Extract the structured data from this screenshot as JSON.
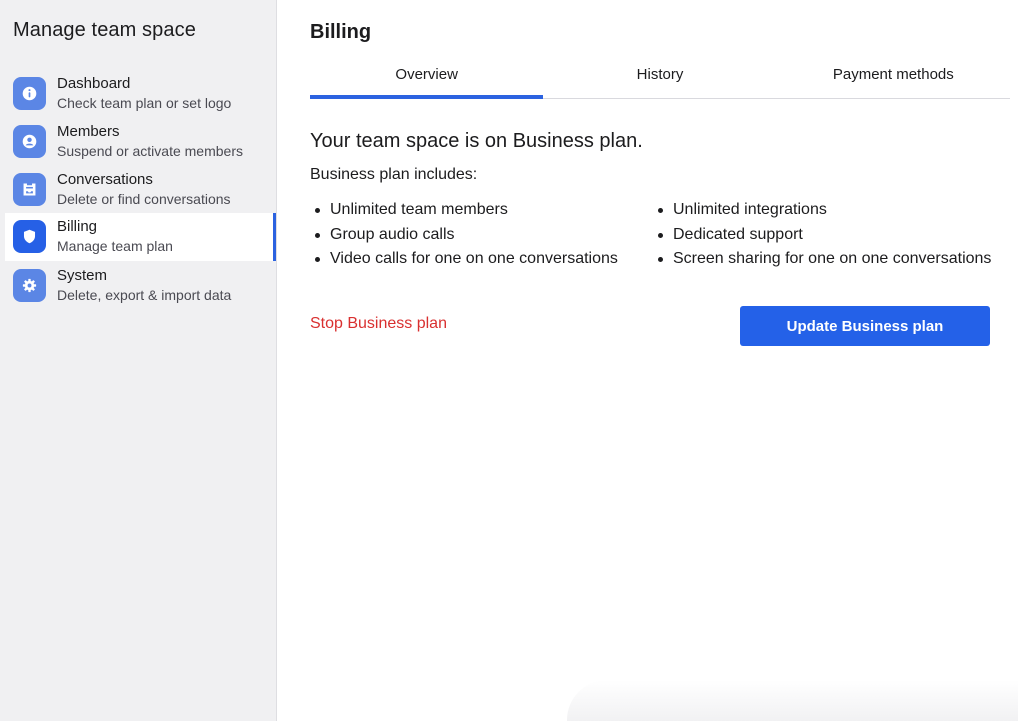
{
  "sidebar": {
    "title": "Manage team space",
    "items": [
      {
        "label": "Dashboard",
        "sub": "Check team plan or set logo",
        "icon": "info-icon",
        "active": false
      },
      {
        "label": "Members",
        "sub": "Suspend or activate members",
        "icon": "user-icon",
        "active": false
      },
      {
        "label": "Conversations",
        "sub": "Delete or find conversations",
        "icon": "inbox-icon",
        "active": false
      },
      {
        "label": "Billing",
        "sub": "Manage team plan",
        "icon": "shield-icon",
        "active": true
      },
      {
        "label": "System",
        "sub": "Delete, export & import data",
        "icon": "gear-icon",
        "active": false
      }
    ]
  },
  "main": {
    "title": "Billing",
    "tabs": [
      {
        "label": "Overview",
        "active": true
      },
      {
        "label": "History",
        "active": false
      },
      {
        "label": "Payment methods",
        "active": false
      }
    ],
    "plan_heading": "Your team space is on Business plan.",
    "plan_includes": "Business plan includes:",
    "features_left": [
      "Unlimited team members",
      "Group audio calls",
      "Video calls for one on one conversations"
    ],
    "features_right": [
      "Unlimited integrations",
      "Dedicated support",
      "Screen sharing for one on one conversations"
    ],
    "stop_label": "Stop Business plan",
    "update_label": "Update Business plan"
  },
  "colors": {
    "accent": "#2461e8",
    "danger": "#d93030",
    "sidebar_bg": "#f0f0f2"
  }
}
